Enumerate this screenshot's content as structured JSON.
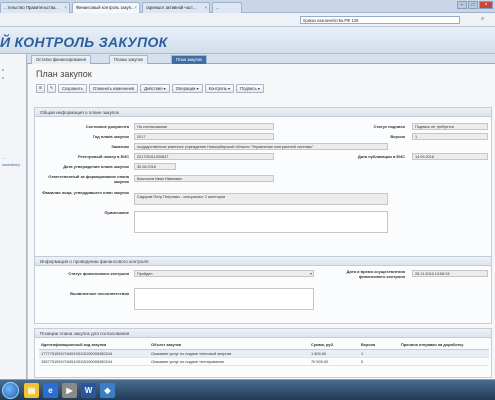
{
  "browser": {
    "tabs": [
      {
        "label": "...тельство Правительства...",
        "active": false
      },
      {
        "label": "Финансовый контроль закуп...",
        "active": true
      },
      {
        "label": "скриншот активной част...",
        "active": false
      },
      {
        "label": "...",
        "active": false
      }
    ],
    "address": "приказ казначейства РФ 128"
  },
  "app": {
    "header_title": "Й КОНТРОЛЬ ЗАКУПОК"
  },
  "left_panel": {
    "stub1": "е",
    "stub2": "п",
    "stub3": "...",
    "stub4": "олнители)"
  },
  "doc_tabs": [
    {
      "label": "Остатки финансирования",
      "active": false
    },
    {
      "label": "Планы закупок",
      "active": false
    },
    {
      "label": "План закупок",
      "active": true
    }
  ],
  "page": {
    "title": "План закупок"
  },
  "toolbar": {
    "save": "Сохранить",
    "cancel": "Отменить изменения",
    "actions": "Действия ▾",
    "operations": "Операции ▾",
    "control": "Контроль ▾",
    "signature": "Подпись ▾"
  },
  "general": {
    "heading": "Общая информация о плане закупок",
    "doc_status_label": "Состояние документа",
    "doc_status": "На согласовании",
    "sign_status_label": "Статус подписи",
    "sign_status": "Подпись не требуется",
    "year_label": "Год плана закупок",
    "year": "2017",
    "version_label": "Версия",
    "version": "1",
    "customer_label": "Заказчик",
    "customer": "государственное казенное учреждение Новосибирской области \"Управление контрактной системы\"",
    "reg_label": "Реестровый номер в ЕИС",
    "reg": "201705311000837",
    "pub_date_label": "Дата публикации в ЕИС",
    "pub_date": "14.09.2016",
    "approve_date_label": "Дата утверждения плана закупок",
    "approve_date": "30.08.2016",
    "responsible_label": "Ответственный за формирование плана закупок",
    "responsible": "Васильев Иван Иванович",
    "approver_label": "Фамилия лица, утвердившего план закупок",
    "approver": "Сидоров Петр Петрович - специалист 2 категории",
    "note_label": "Примечание",
    "note": ""
  },
  "control": {
    "heading": "Информация о проведении финансового контроля",
    "status_label": "Статус финансового контроля",
    "status": "Пройден",
    "datetime_label": "Дата и время осуществления финансового контроля",
    "datetime": "28.11.2016 13:58:24",
    "issues_label": "Выявленные несоответствия",
    "issues": ""
  },
  "items": {
    "heading": "Позиции плана закупок для согласования",
    "columns": [
      "Идентификационный код закупки",
      "Объект закупки",
      "Сумма, руб.",
      "Версия",
      "Причина отправки на доработку"
    ],
    "rows": [
      [
        "177775193471545105115160006350244",
        "Оказание услуг по подаче тепловой энергии",
        "1 500,00",
        "1",
        ""
      ],
      [
        "335775193471545105115160006350244",
        "Оказание услуг по подаче тестирования",
        "70 500,00",
        "0",
        ""
      ]
    ]
  },
  "colors": {
    "accent": "#3d6ea6",
    "header_text": "#2c5f9e"
  }
}
